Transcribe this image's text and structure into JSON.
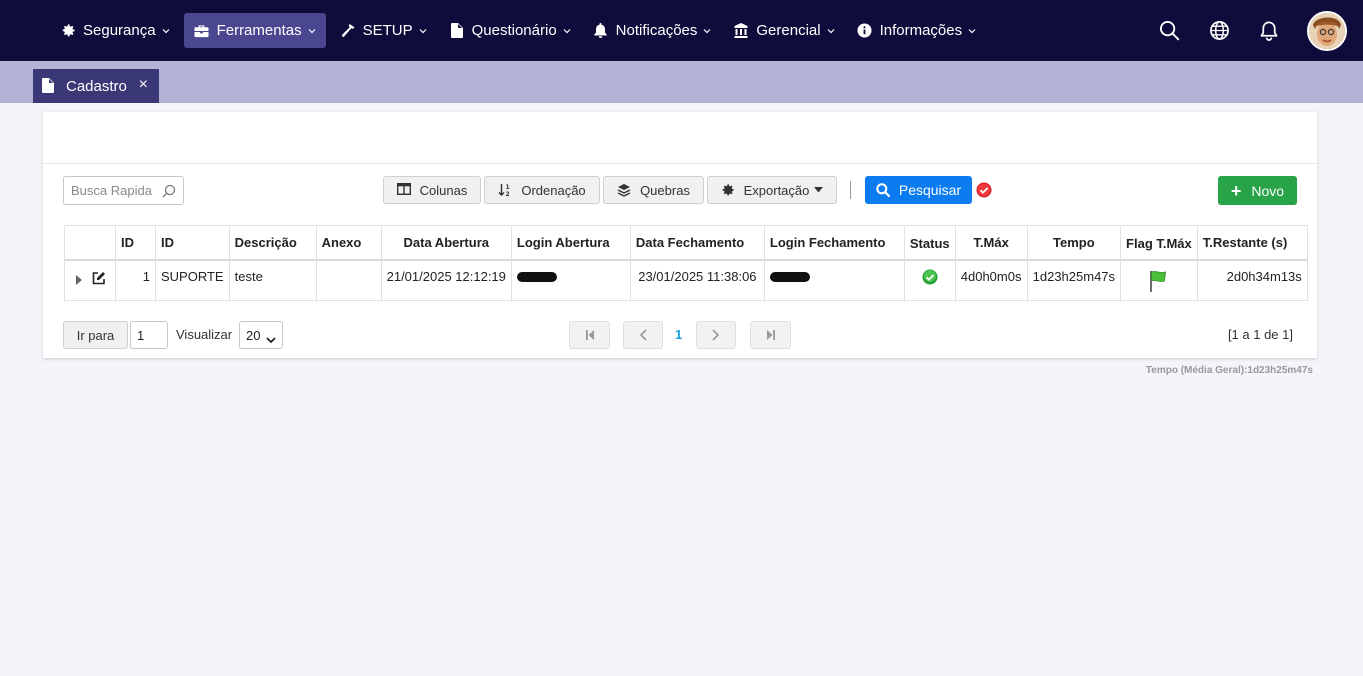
{
  "nav": {
    "items": [
      {
        "label": "Segurança",
        "icon": "gear-icon"
      },
      {
        "label": "Ferramentas",
        "icon": "toolbox-icon"
      },
      {
        "label": "SETUP",
        "icon": "hammer-icon"
      },
      {
        "label": "Questionário",
        "icon": "file-icon"
      },
      {
        "label": "Notificações",
        "icon": "bell-icon"
      },
      {
        "label": "Gerencial",
        "icon": "building-icon"
      },
      {
        "label": "Informações",
        "icon": "info-icon"
      }
    ],
    "active_index": 1,
    "right_icons": [
      "search-icon",
      "globe-icon",
      "bell-icon",
      "avatar"
    ]
  },
  "tab": {
    "label": "Cadastro",
    "close": "×"
  },
  "toolbar": {
    "search_placeholder": "Busca Rapida",
    "colunas": "Colunas",
    "ordenacao": "Ordenação",
    "quebras": "Quebras",
    "exportacao": "Exportação",
    "pesquisar": "Pesquisar",
    "novo": "Novo"
  },
  "table": {
    "headers": [
      "",
      "ID",
      "ID",
      "Descrição",
      "Anexo",
      "Data Abertura",
      "Login Abertura",
      "Data Fechamento",
      "Login Fechamento",
      "Status",
      "T.Máx",
      "Tempo",
      "Flag T.Máx",
      "T.Restante (s)"
    ],
    "rows": [
      {
        "id1": "1",
        "id2": "SUPORTE",
        "descricao": "teste",
        "anexo": "",
        "data_abertura": "21/01/2025 12:12:19",
        "data_fechamento": "23/01/2025 11:38:06",
        "tmax": "4d0h0m0s",
        "tempo": "1d23h25m47s",
        "trestante": "2d0h34m13s",
        "status_icon": "check-circle-icon",
        "flag_icon": "green-flag-icon"
      }
    ]
  },
  "pager": {
    "goto_label": "Ir para",
    "goto_value": "1",
    "view_label": "Visualizar",
    "page_size": "20",
    "current_page": "1",
    "range": "[1 a 1 de 1]"
  },
  "footer": {
    "stat": "Tempo (Média Geral):1d23h25m47s"
  },
  "colors": {
    "navbar": "#0f0b3a",
    "tabstrip": "#b4b3d6",
    "primary": "#0a7cf0",
    "success": "#29a347",
    "active_nav": "#4a4790"
  }
}
